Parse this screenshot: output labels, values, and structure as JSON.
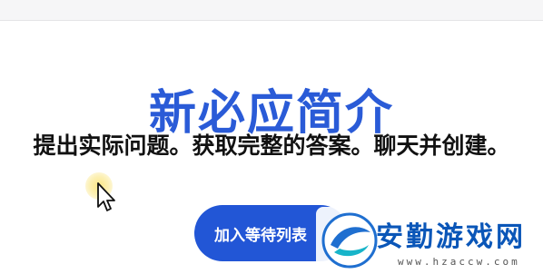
{
  "hero": {
    "title": "新必应简介",
    "subtitle": "提出实际问题。获取完整的答案。聊天并创建。"
  },
  "cta": {
    "label": "加入等待列表"
  },
  "cursor": {
    "icon": "mouse-pointer-icon"
  },
  "watermark": {
    "name": "安勤游戏网",
    "url": "www.hzaccw.com",
    "icon": "site-logo-icon"
  },
  "colors": {
    "title": "#2a5bd7",
    "button": "#2256d6",
    "watermark": "#0a56b8",
    "highlight": "#fae478"
  }
}
